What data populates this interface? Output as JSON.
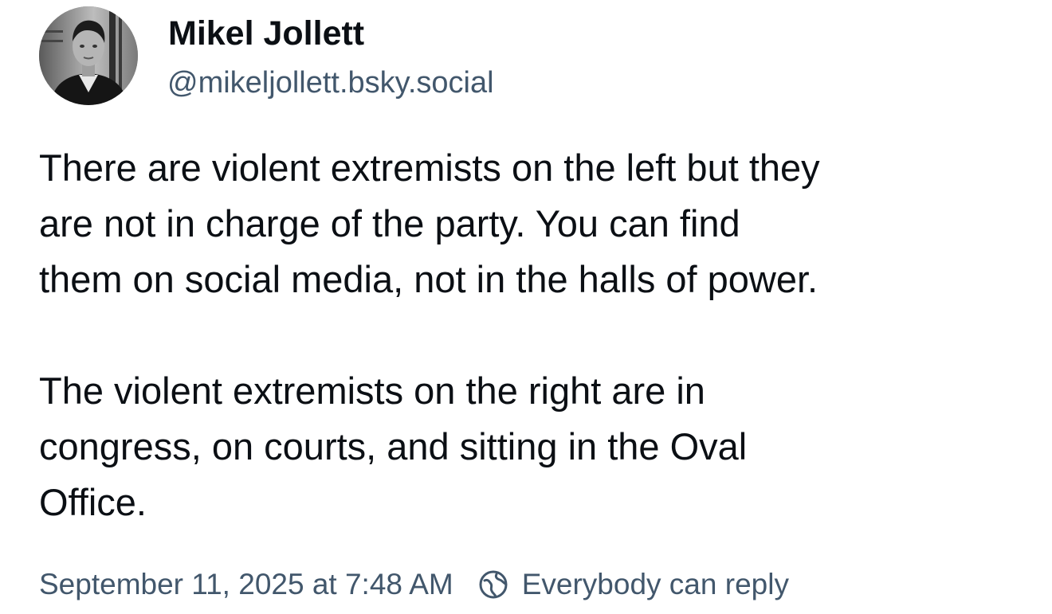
{
  "post": {
    "author": {
      "display_name": "Mikel Jollett",
      "handle": "@mikeljollett.bsky.social",
      "avatar_icon": "profile-photo"
    },
    "paragraphs": [
      "There are violent extremists on the left but they\nare not in charge of the party. You can find\nthem on social media, not in the halls of power.",
      "The violent extremists on the right are in\ncongress, on courts, and sitting in the Oval\nOffice."
    ],
    "timestamp": "September 11, 2025 at 7:48 AM",
    "reply_setting": {
      "icon": "globe-reply-icon",
      "label": "Everybody can reply"
    }
  },
  "colors": {
    "text_primary": "#0b0f14",
    "text_secondary": "#42576c",
    "background": "#ffffff"
  }
}
